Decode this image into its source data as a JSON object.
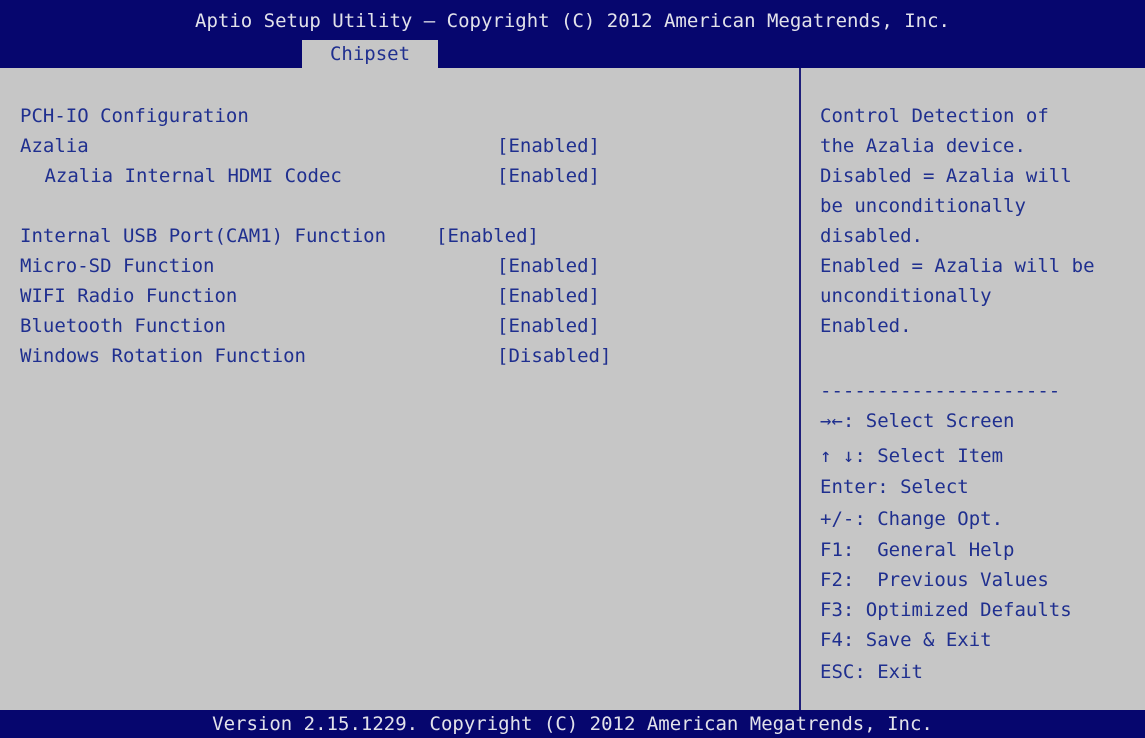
{
  "header": {
    "title": "Aptio Setup Utility – Copyright (C) 2012 American Megatrends, Inc.",
    "active_tab": "Chipset"
  },
  "main": {
    "section_title": "PCH-IO Configuration",
    "settings": [
      {
        "label": "Azalia",
        "value": "[Enabled]"
      },
      {
        "label": " Azalia Internal HDMI Codec",
        "value": "[Enabled]"
      },
      {
        "label": "Internal USB Port(CAM1) Function",
        "value": "[Enabled]"
      },
      {
        "label": "Micro-SD Function",
        "value": "[Enabled]"
      },
      {
        "label": "WIFI Radio Function",
        "value": "[Enabled]"
      },
      {
        "label": "Bluetooth Function",
        "value": "[Enabled]"
      },
      {
        "label": "Windows Rotation Function",
        "value": "[Disabled]"
      }
    ]
  },
  "help": {
    "lines": [
      "Control Detection of",
      "the Azalia device.",
      "Disabled = Azalia will",
      "be unconditionally",
      "disabled.",
      "Enabled = Azalia will be",
      "unconditionally",
      "Enabled."
    ],
    "separator": "---------------------",
    "keys": [
      "→←: Select Screen",
      "↑ ↓: Select Item",
      "Enter: Select",
      "+/-: Change Opt.",
      "F1:  General Help",
      "F2:  Previous Values",
      "F3: Optimized Defaults",
      "F4: Save & Exit",
      "ESC: Exit"
    ]
  },
  "footer": {
    "version": "Version 2.15.1229. Copyright (C) 2012 American Megatrends, Inc."
  },
  "colors": {
    "bar_background": "#06066e",
    "panel_background": "#c6c6c6",
    "text": "#1f2f8f",
    "bar_text": "#e2e2ea"
  }
}
